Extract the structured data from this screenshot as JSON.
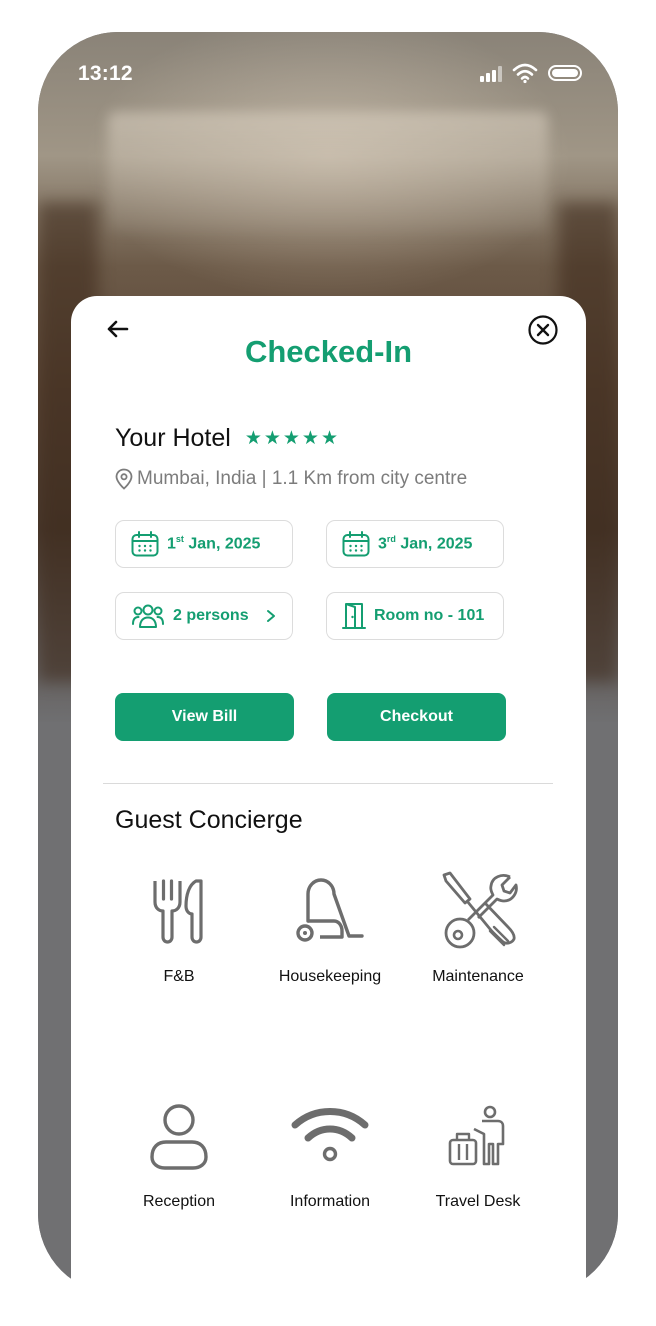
{
  "status_bar": {
    "time": "13:12"
  },
  "header": {
    "title": "Checked-In"
  },
  "hotel": {
    "name": "Your Hotel",
    "stars": "★★★★★",
    "rating": 5,
    "location": "Mumbai, India | 1.1 Km from city centre"
  },
  "booking": {
    "checkin_day": "1",
    "checkin_suffix": "st",
    "checkin_rest": " Jan, 2025",
    "checkout_day": "3",
    "checkout_suffix": "rd",
    "checkout_rest": " Jan, 2025",
    "guests": "2 persons",
    "room": "Room no - 101"
  },
  "actions": {
    "view_bill": "View Bill",
    "checkout": "Checkout"
  },
  "concierge": {
    "title": "Guest Concierge",
    "services": [
      {
        "label": "F&B",
        "icon": "fork-knife-icon"
      },
      {
        "label": "Housekeeping",
        "icon": "vacuum-cleaner-icon"
      },
      {
        "label": "Maintenance",
        "icon": "tools-icon"
      },
      {
        "label": "Reception",
        "icon": "person-icon"
      },
      {
        "label": "Information",
        "icon": "wifi-icon"
      },
      {
        "label": "Travel Desk",
        "icon": "traveler-luggage-icon"
      }
    ]
  },
  "colors": {
    "accent": "#149e71",
    "muted": "#7c7c7c",
    "icon": "#6d6d6d"
  }
}
